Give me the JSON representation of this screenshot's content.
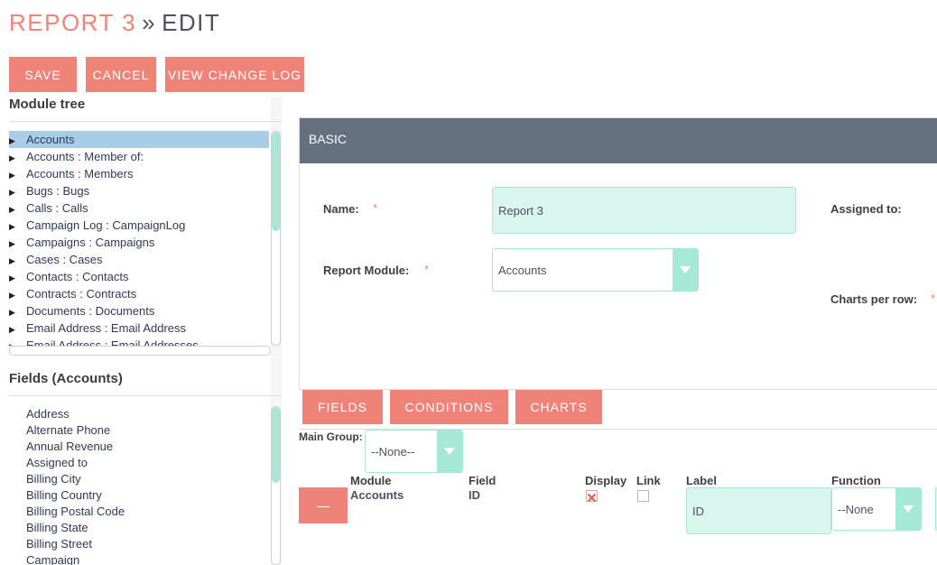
{
  "header": {
    "title_record": "REPORT 3",
    "title_separator": "»",
    "title_action": "EDIT"
  },
  "toolbar": {
    "save_label": "SAVE",
    "cancel_label": "CANCEL",
    "changelog_label": "VIEW CHANGE LOG"
  },
  "module_tree": {
    "title": "Module tree",
    "items": [
      "Accounts",
      "Accounts : Member of:",
      "Accounts : Members",
      "Bugs : Bugs",
      "Calls : Calls",
      "Campaign Log : CampaignLog",
      "Campaigns : Campaigns",
      "Cases : Cases",
      "Contacts : Contacts",
      "Contracts : Contracts",
      "Documents : Documents",
      "Email Address : Email Address",
      "Email Address : Email Addresses"
    ],
    "selected_index": 0
  },
  "fields": {
    "title": "Fields (Accounts)",
    "items": [
      "Address",
      "Alternate Phone",
      "Annual Revenue",
      "Assigned to",
      "Billing City",
      "Billing Country",
      "Billing Postal Code",
      "Billing State",
      "Billing Street",
      "Campaign"
    ]
  },
  "basic_panel": {
    "header": "BASIC",
    "name_label": "Name:",
    "name_value": "Report 3",
    "report_module_label": "Report Module:",
    "report_module_value": "Accounts",
    "assigned_to_label": "Assigned to:",
    "charts_per_row_label": "Charts per row:",
    "required_marker": "*"
  },
  "tabs": {
    "fields": "FIELDS",
    "conditions": "CONDITIONS",
    "charts": "CHARTS"
  },
  "main_group": {
    "label": "Main Group:",
    "value": "--None--"
  },
  "field_table": {
    "headers": {
      "module": "Module",
      "field": "Field",
      "display": "Display",
      "link": "Link",
      "label": "Label",
      "function": "Function"
    },
    "rows": [
      {
        "remove_label": "—",
        "module": "Accounts",
        "field": "ID",
        "display_checked": true,
        "link_checked": false,
        "label": "ID",
        "function": "--None"
      }
    ]
  },
  "colors": {
    "accent": "#f08377",
    "panel_header": "#65707f",
    "input_bg": "#d8f5ee",
    "input_border": "#a5e8d5",
    "selection": "#a9cde6"
  }
}
